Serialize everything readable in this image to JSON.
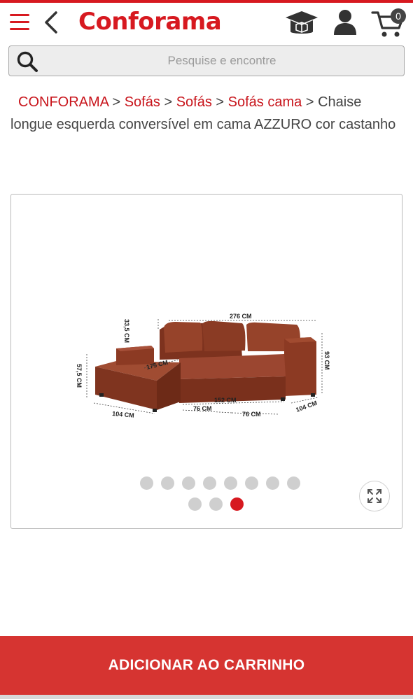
{
  "header": {
    "logo": "Conforama",
    "cart_count": "0",
    "icons": [
      "menu-icon",
      "back-arrow-icon",
      "graduation-cap-icon",
      "user-icon",
      "cart-icon"
    ]
  },
  "search": {
    "placeholder": "Pesquise e encontre"
  },
  "breadcrumb": {
    "items": [
      "CONFORAMA",
      "Sofás",
      "Sofás",
      "Sofás cama"
    ],
    "separator": ">",
    "current": "Chaise longue esquerda conversível em cama AZZURO cor castanho"
  },
  "gallery": {
    "dimensions": {
      "width_top": "276 CM",
      "back_height": "33,5 CM",
      "total_height": "93 CM",
      "chaise_width": "175 CM",
      "chaise_height": "57,5 CM",
      "chaise_depth": "104 CM",
      "seat_width": "152 CM",
      "seat_left": "76 CM",
      "seat_right": "76 CM",
      "depth": "104 CM"
    },
    "dots_total": 11,
    "active_dot": 11,
    "zoom_icon": "expand-icon"
  },
  "actions": {
    "add_to_cart": "ADICIONAR AO CARRINHO"
  },
  "colors": {
    "brand": "#d71920",
    "button": "#d63431",
    "sofa": "#8e3a24"
  }
}
